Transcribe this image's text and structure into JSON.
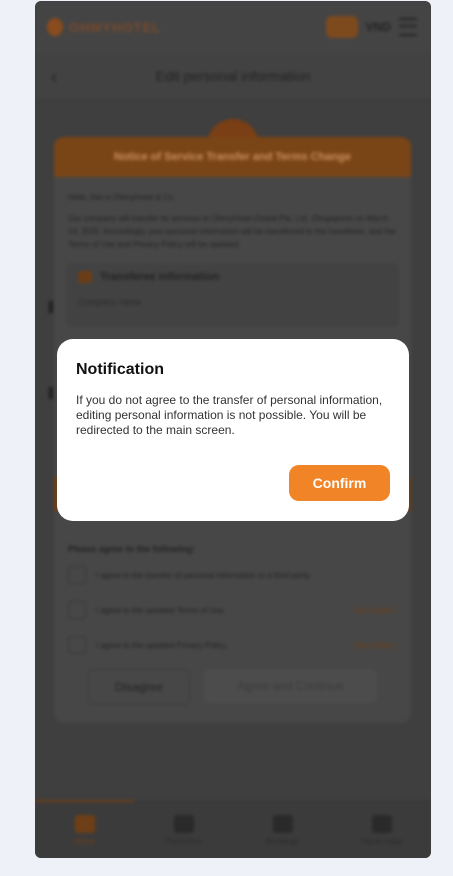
{
  "header": {
    "brand": "OHMYHOTEL",
    "currency": "VND"
  },
  "page": {
    "title": "Edit personal information"
  },
  "terms_dialog": {
    "title": "Notice of Service Transfer and Terms Change",
    "greeting": "Hello, this is OhmyHotel & Co.",
    "body": "Our company will transfer its services to OhmyHotel Global Pte. Ltd. (Singapore) on March 14, 2025. Accordingly, your personal information will be transferred to the transferee, and the Terms of Use and Privacy Policy will be updated.",
    "transferee_title": "Transferee information",
    "company_name_label": "Company name",
    "agree_title": "Please agree to the following:",
    "agreements": [
      {
        "label": "I agree to the transfer of personal information to a third party.",
        "detail": ""
      },
      {
        "label": "I agree to the updated Terms of Use.",
        "detail": "View detail"
      },
      {
        "label": "I agree to the updated Privacy Policy.",
        "detail": "View detail"
      }
    ],
    "disagree_label": "Disagree",
    "agree_label": "Agree and Continue"
  },
  "bottom_nav": [
    {
      "label": "Home",
      "active": true
    },
    {
      "label": "Promotion",
      "active": false
    },
    {
      "label": "Bookings",
      "active": false
    },
    {
      "label": "Trip & notes",
      "active": false
    }
  ],
  "notification": {
    "title": "Notification",
    "message": "If you do not agree to the transfer of personal information, editing personal information is not possible. You will be redirected to the main screen.",
    "confirm_label": "Confirm"
  },
  "colors": {
    "accent": "#f08427",
    "overlay": "#3f3f3f",
    "background": "#eef2f8"
  }
}
